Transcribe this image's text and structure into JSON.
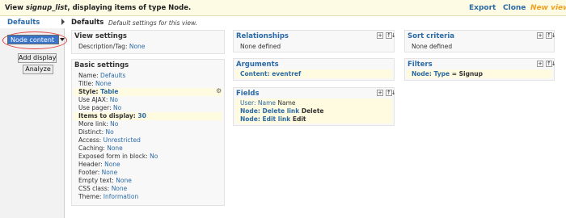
{
  "header": {
    "title_prefix": "View ",
    "title_view": "signup_list",
    "title_suffix": ", displaying items of type Node.",
    "links": {
      "export": "Export",
      "clone": "Clone",
      "new_view": "New view"
    }
  },
  "left": {
    "tab_label": "Defaults",
    "select_value": "Node content",
    "add_display": "Add display",
    "analyze": "Analyze"
  },
  "main": {
    "title": "Defaults",
    "description": "Default settings for this view."
  },
  "panels": {
    "view_settings": {
      "title": "View settings",
      "rows": [
        {
          "label": "Description/Tag:",
          "value": "None"
        }
      ]
    },
    "basic_settings": {
      "title": "Basic settings",
      "rows": [
        {
          "label": "Name:",
          "value": "Defaults"
        },
        {
          "label": "Title:",
          "value": "None"
        },
        {
          "label": "Style:",
          "value": "Table"
        },
        {
          "label": "Use AJAX:",
          "value": "No"
        },
        {
          "label": "Use pager:",
          "value": "No"
        },
        {
          "label": "Items to display:",
          "value": "30"
        },
        {
          "label": "More link:",
          "value": "No"
        },
        {
          "label": "Distinct:",
          "value": "No"
        },
        {
          "label": "Access:",
          "value": "Unrestricted"
        },
        {
          "label": "Caching:",
          "value": "None"
        },
        {
          "label": "Exposed form in block:",
          "value": "No"
        },
        {
          "label": "Header:",
          "value": "None"
        },
        {
          "label": "Footer:",
          "value": "None"
        },
        {
          "label": "Empty text:",
          "value": "None"
        },
        {
          "label": "CSS class:",
          "value": "None"
        },
        {
          "label": "Theme:",
          "value": "Information"
        }
      ]
    },
    "relationships": {
      "title": "Relationships",
      "empty": "None defined"
    },
    "arguments": {
      "title": "Arguments",
      "rows": [
        {
          "label": "Content:",
          "value": "eventref"
        }
      ]
    },
    "fields": {
      "title": "Fields",
      "rows": [
        {
          "label": "User: Name",
          "value": "Name"
        },
        {
          "label": "Node: Delete link",
          "value": "Delete"
        },
        {
          "label": "Node: Edit link",
          "value": "Edit"
        }
      ]
    },
    "sort_criteria": {
      "title": "Sort criteria",
      "empty": "None defined"
    },
    "filters": {
      "title": "Filters",
      "rows": [
        {
          "label": "Node: Type",
          "op": "=",
          "value": "Signup"
        }
      ]
    }
  },
  "icons": {
    "add": "+",
    "rearrange": "↑↓",
    "gear": "⚙"
  }
}
